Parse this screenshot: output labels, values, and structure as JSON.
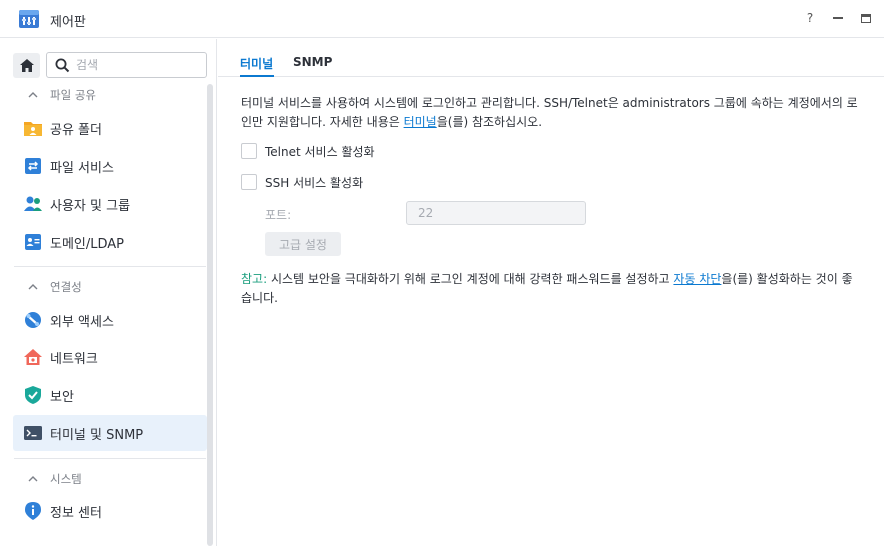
{
  "window": {
    "title": "제어판",
    "help_glyph": "?"
  },
  "sidebar": {
    "search_placeholder": "검색",
    "sections": [
      {
        "header": "파일 공유",
        "items": [
          {
            "label": "공유 폴더",
            "icon": "shared-folder-icon"
          },
          {
            "label": "파일 서비스",
            "icon": "file-services-icon"
          },
          {
            "label": "사용자 및 그룹",
            "icon": "users-groups-icon"
          },
          {
            "label": "도메인/LDAP",
            "icon": "domain-ldap-icon"
          }
        ]
      },
      {
        "header": "연결성",
        "items": [
          {
            "label": "외부 액세스",
            "icon": "external-access-icon"
          },
          {
            "label": "네트워크",
            "icon": "network-icon"
          },
          {
            "label": "보안",
            "icon": "security-shield-icon"
          },
          {
            "label": "터미널 및 SNMP",
            "icon": "terminal-icon",
            "active": true
          }
        ]
      },
      {
        "header": "시스템",
        "items": [
          {
            "label": "정보 센터",
            "icon": "info-center-icon"
          }
        ]
      }
    ]
  },
  "main": {
    "tabs": [
      {
        "label": "터미널",
        "active": true
      },
      {
        "label": "SNMP",
        "active": false
      }
    ],
    "description": {
      "line1": "터미널 서비스를 사용하여 시스템에 로그인하고 관리합니다. SSH/Telnet은 administrators 그룹에 속하는 계정에서의 로",
      "line2_before": "인만 지원합니다. 자세한 내용은 ",
      "line2_link": "터미널",
      "line2_after": "을(를) 참조하십시오."
    },
    "telnet_label": "Telnet 서비스 활성화",
    "ssh_label": "SSH 서비스 활성화",
    "port_label": "포트:",
    "port_value": "22",
    "advanced_button": "고급 설정",
    "note": {
      "prefix": "참고:",
      "text_before": " 시스템 보안을 극대화하기 위해 로그인 계정에 대해 강력한 패스워드를 설정하고 ",
      "link": "자동 차단",
      "text_after": "을(를) 활성화하는 것이 좋",
      "line2": "습니다."
    }
  },
  "colors": {
    "accent": "#0b79d0",
    "note_prefix": "#1a9e7e",
    "active_nav_bg": "#e8f1fb"
  }
}
